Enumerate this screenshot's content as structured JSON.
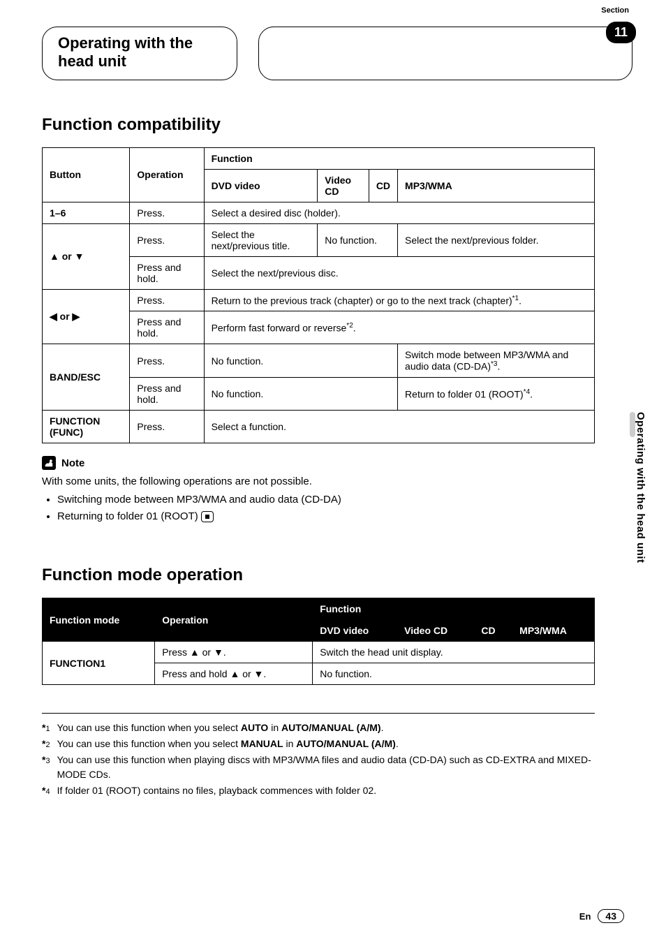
{
  "header": {
    "title": "Operating with the head unit",
    "section_label": "Section",
    "section_number": "11"
  },
  "side_tab": "Operating with the head unit",
  "sec1": {
    "heading": "Function compatibility",
    "cols": {
      "button": "Button",
      "operation": "Operation",
      "function": "Function",
      "dvd": "DVD video",
      "vcd": "Video CD",
      "cd": "CD",
      "mp3": "MP3/WMA"
    },
    "r1": {
      "button": "1–6",
      "op": "Press.",
      "fn": "Select a desired disc (holder)."
    },
    "r2": {
      "button": "▲ or ▼",
      "op1": "Press.",
      "fn1a": "Select the next/previous title.",
      "fn1b": "No function.",
      "fn1c": "Select the next/previous folder.",
      "op2": "Press and hold.",
      "fn2": "Select the next/previous disc."
    },
    "r3": {
      "button": "◀ or ▶",
      "op1": "Press.",
      "fn1_pre": "Return to the previous track (chapter) or go to the next track (chapter)",
      "fn1_sup": "*1",
      "fn1_post": ".",
      "op2": "Press and hold.",
      "fn2_pre": "Perform fast forward or reverse",
      "fn2_sup": "*2",
      "fn2_post": "."
    },
    "r4": {
      "button": "BAND/ESC",
      "op1": "Press.",
      "fn1a": "No function.",
      "fn1b_pre": "Switch mode between MP3/WMA and audio data (CD-DA)",
      "fn1b_sup": "*3",
      "fn1b_post": ".",
      "op2": "Press and hold.",
      "fn2a": "No function.",
      "fn2b_pre": "Return to folder 01 (ROOT)",
      "fn2b_sup": "*4",
      "fn2b_post": "."
    },
    "r5": {
      "button": "FUNCTION (FUNC)",
      "op": "Press.",
      "fn": "Select a function."
    }
  },
  "note": {
    "label": "Note",
    "intro": "With some units, the following operations are not possible.",
    "b1": "Switching mode between MP3/WMA and audio data (CD-DA)",
    "b2": "Returning to folder 01 (ROOT)"
  },
  "sec2": {
    "heading": "Function mode operation",
    "cols": {
      "mode": "Function mode",
      "operation": "Operation",
      "function": "Function",
      "dvd": "DVD video",
      "vcd": "Video CD",
      "cd": "CD",
      "mp3": "MP3/WMA"
    },
    "r1": {
      "mode": "FUNCTION1",
      "op1": "Press ▲ or ▼.",
      "fn1": "Switch the head unit display.",
      "op2": "Press and hold ▲ or ▼.",
      "fn2": "No function."
    }
  },
  "footnotes": {
    "f1": {
      "mark": "*",
      "n": "1",
      "pre": "You can use this function when you select ",
      "b1": "AUTO",
      "mid": " in ",
      "b2": "AUTO/MANUAL (A/M)",
      "post": "."
    },
    "f2": {
      "mark": "*",
      "n": "2",
      "pre": "You can use this function when you select ",
      "b1": "MANUAL",
      "mid": " in ",
      "b2": "AUTO/MANUAL (A/M)",
      "post": "."
    },
    "f3": {
      "mark": "*",
      "n": "3",
      "text": "You can use this function when playing discs with MP3/WMA files and audio data (CD-DA) such as CD-EXTRA and MIXED-MODE CDs."
    },
    "f4": {
      "mark": "*",
      "n": "4",
      "text": "If folder 01 (ROOT) contains no files, playback commences with folder 02."
    }
  },
  "footer": {
    "lang": "En",
    "page": "43"
  }
}
